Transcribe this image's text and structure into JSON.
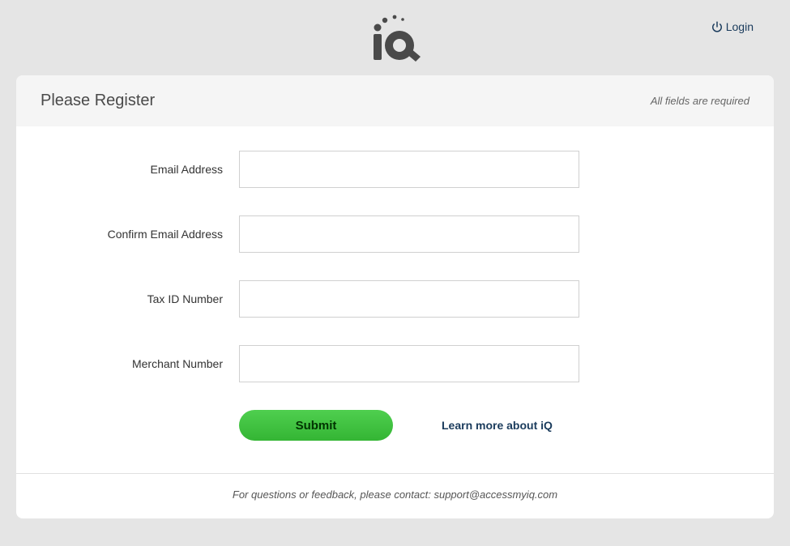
{
  "header": {
    "login_label": "Login"
  },
  "card": {
    "title": "Please Register",
    "required_note": "All fields are required"
  },
  "form": {
    "fields": [
      {
        "label": "Email Address",
        "value": ""
      },
      {
        "label": "Confirm Email Address",
        "value": ""
      },
      {
        "label": "Tax ID Number",
        "value": ""
      },
      {
        "label": "Merchant Number",
        "value": ""
      }
    ],
    "submit_label": "Submit",
    "learn_more_label": "Learn more about iQ"
  },
  "footer": {
    "text": "For questions or feedback, please contact: support@accessmyiq.com"
  }
}
